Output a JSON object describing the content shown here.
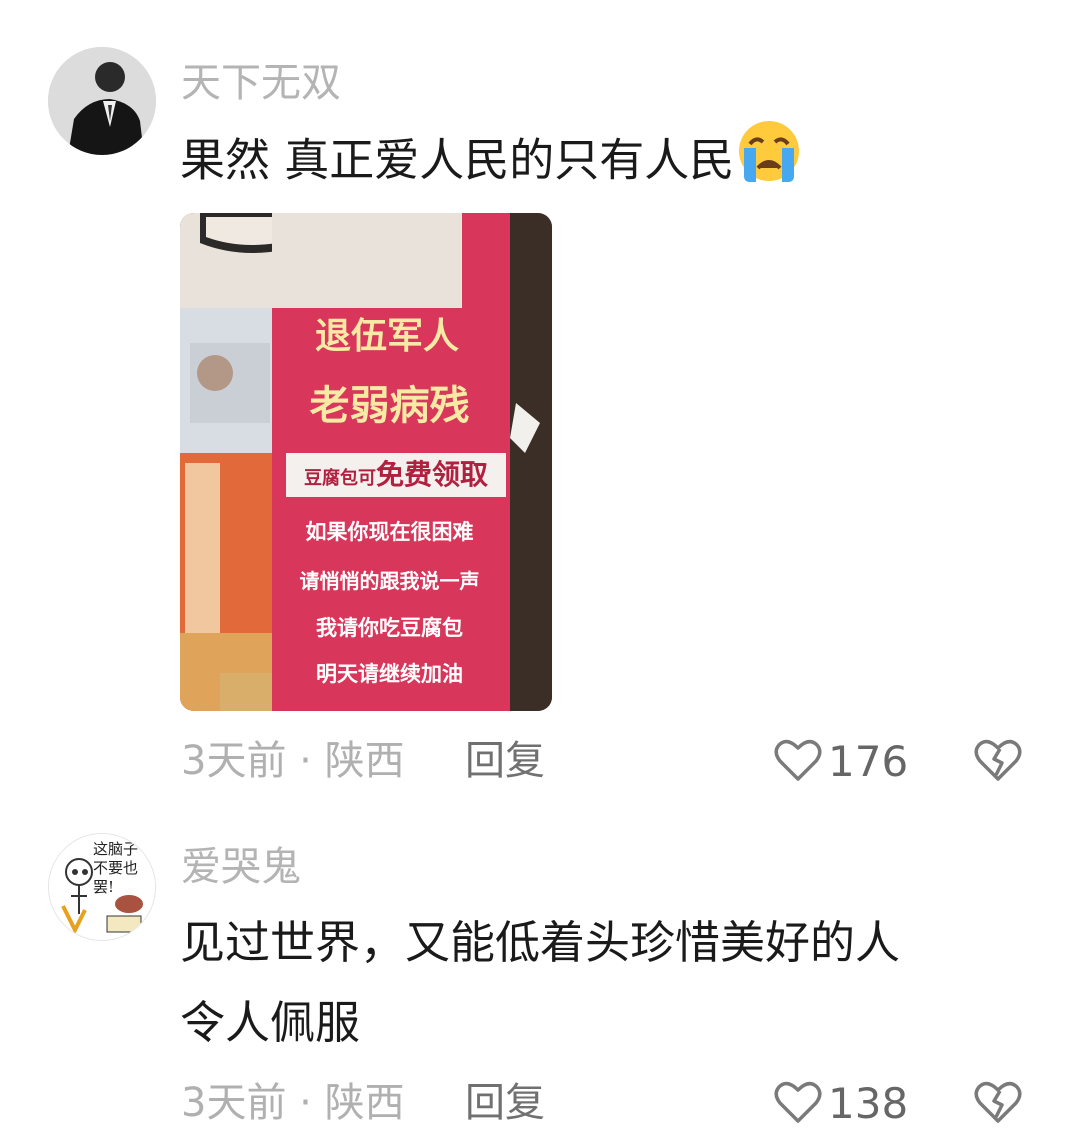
{
  "comments": [
    {
      "username": "天下无双",
      "text": "果然 真正爱人民的只有人民",
      "emoji": "loudly-crying-face",
      "image": {
        "sign_lines": [
          "退伍军人",
          "老弱病残",
          "如果你现在很困难",
          "请悄悄的跟我说一声",
          "我请你吃豆腐包",
          "明天请继续加油"
        ],
        "sign_box_small": "豆腐包可",
        "sign_box_big": "免费领取"
      },
      "time": "3天前",
      "separator": "·",
      "location": "陕西",
      "reply_label": "回复",
      "likes": "176"
    },
    {
      "username": "爱哭鬼",
      "text_line1": "见过世界，又能低着头珍惜美好的人",
      "text_line2": "令人佩服",
      "avatar_text": "这脑子不要也罢!",
      "time": "3天前",
      "separator": "·",
      "location": "陕西",
      "reply_label": "回复",
      "likes": "138"
    }
  ],
  "colors": {
    "username": "#b4b4b4",
    "body": "#1a1a1a",
    "meta": "#b0b0b0",
    "sign_red": "#d8365a"
  }
}
